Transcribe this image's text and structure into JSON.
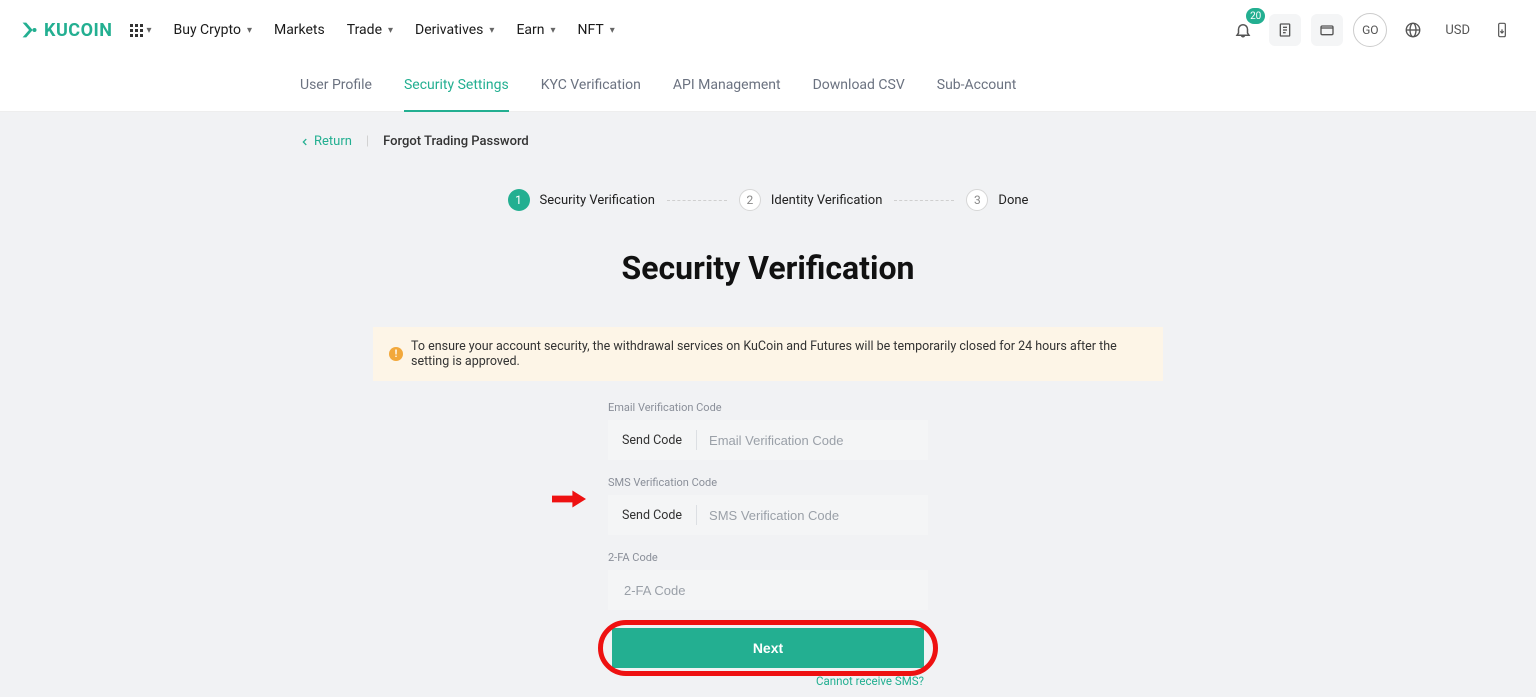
{
  "brand": {
    "name": "KUCOIN"
  },
  "nav": {
    "items": [
      {
        "label": "Buy Crypto",
        "caret": true
      },
      {
        "label": "Markets",
        "caret": false
      },
      {
        "label": "Trade",
        "caret": true
      },
      {
        "label": "Derivatives",
        "caret": true
      },
      {
        "label": "Earn",
        "caret": true
      },
      {
        "label": "NFT",
        "caret": true
      }
    ]
  },
  "topright": {
    "badge_count": "20",
    "go_label": "GO",
    "currency": "USD"
  },
  "tabs": [
    {
      "label": "User Profile",
      "active": false
    },
    {
      "label": "Security Settings",
      "active": true
    },
    {
      "label": "KYC Verification",
      "active": false
    },
    {
      "label": "API Management",
      "active": false
    },
    {
      "label": "Download CSV",
      "active": false
    },
    {
      "label": "Sub-Account",
      "active": false
    }
  ],
  "breadcrumb": {
    "return": "Return",
    "title": "Forgot Trading Password"
  },
  "steps": [
    {
      "num": "1",
      "label": "Security Verification",
      "active": true
    },
    {
      "num": "2",
      "label": "Identity Verification",
      "active": false
    },
    {
      "num": "3",
      "label": "Done",
      "active": false
    }
  ],
  "page": {
    "title": "Security Verification"
  },
  "warning": "To ensure your account security, the withdrawal services on KuCoin and Futures will be temporarily closed for 24 hours after the setting is approved.",
  "form": {
    "email": {
      "label": "Email Verification Code",
      "send": "Send Code",
      "placeholder": "Email Verification Code"
    },
    "sms": {
      "label": "SMS Verification Code",
      "send": "Send Code",
      "placeholder": "SMS Verification Code"
    },
    "tfa": {
      "label": "2-FA Code",
      "placeholder": "2-FA Code"
    },
    "next": "Next",
    "cannot": "Cannot receive SMS?"
  }
}
